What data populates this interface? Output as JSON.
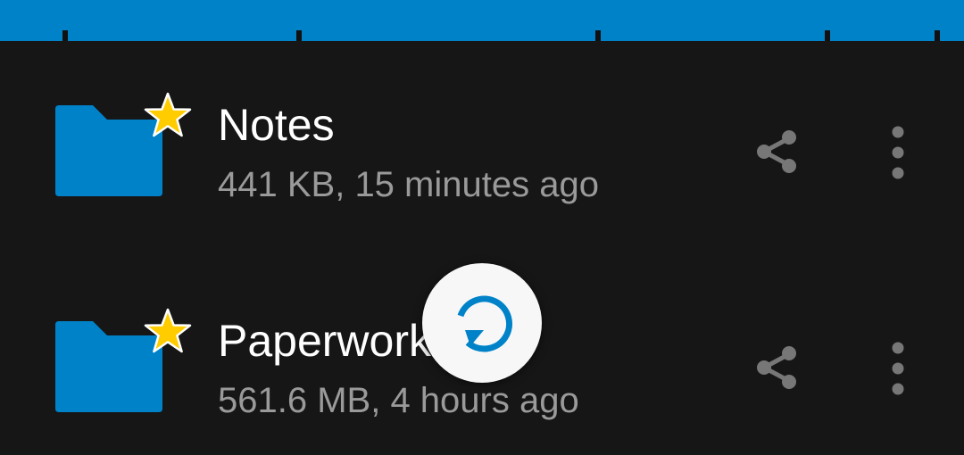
{
  "colors": {
    "accent": "#0082c9",
    "background": "#161616",
    "star": "#ffcc00",
    "text_primary": "#ffffff",
    "text_secondary": "#9a9a9a"
  },
  "files": [
    {
      "name": "Notes",
      "meta": "441 KB, 15 minutes ago",
      "favorite": true,
      "icons": {
        "type": "folder-icon",
        "favorite": "star-icon",
        "share": "share-icon",
        "menu": "more-vertical-icon"
      }
    },
    {
      "name": "Paperwork",
      "meta": "561.6 MB, 4 hours ago",
      "favorite": true,
      "icons": {
        "type": "folder-icon",
        "favorite": "star-icon",
        "share": "share-icon",
        "menu": "more-vertical-icon"
      }
    }
  ],
  "refresh_indicator": {
    "icon": "refresh-icon"
  }
}
